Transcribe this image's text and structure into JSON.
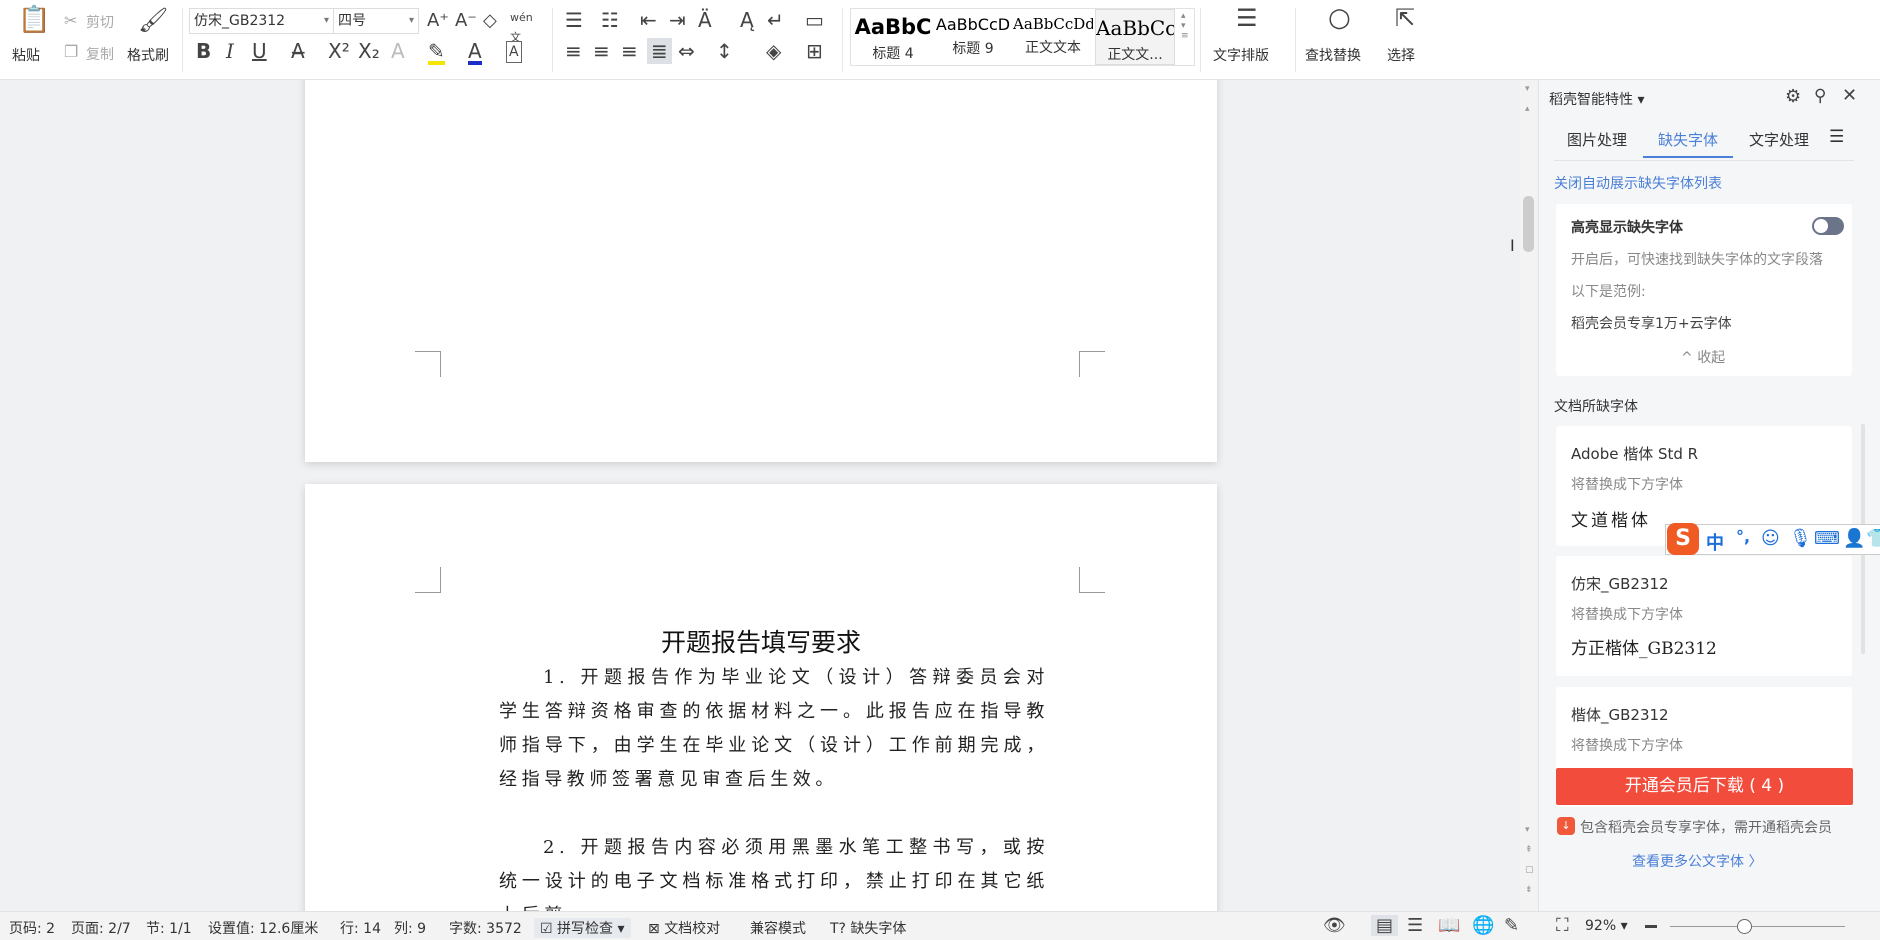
{
  "toolbar": {
    "paste": "粘贴",
    "cut": "剪切",
    "copy": "复制",
    "format_painter": "格式刷",
    "font_name": "仿宋_GB2312",
    "font_size": "四号",
    "styles": [
      {
        "preview": "AaBbC",
        "label": "标题 4"
      },
      {
        "preview": "AaBbCcD",
        "label": "标题 9"
      },
      {
        "preview": "AaBbCcDd",
        "label": "正文文本"
      },
      {
        "preview": "AaBbCc",
        "label": "正文文..."
      }
    ],
    "text_layout": "文字排版",
    "find_replace": "查找替换",
    "select": "选择",
    "pinyin": "wén"
  },
  "document": {
    "title": "开题报告填写要求",
    "paragraphs": [
      "1. 开题报告作为毕业论文（设计）答辩委员会对学生答辩资格审查的依据材料之一。此报告应在指导教师指导下，由学生在毕业论文（设计）工作前期完成，经指导教师签署意见审查后生效。",
      "2. 开题报告内容必须用黑墨水笔工整书写，或按统一设计的电子文档标准格式打印，禁止打印在其它纸上后剪"
    ]
  },
  "panel": {
    "title": "稻壳智能特性",
    "tabs": [
      "图片处理",
      "缺失字体",
      "文字处理"
    ],
    "active_tab": 1,
    "close_auto_link": "关闭自动展示缺失字体列表",
    "highlight": {
      "title": "高亮显示缺失字体",
      "enabled": false,
      "desc": "开启后，可快速找到缺失字体的文字段落",
      "example_label": "以下是范例:",
      "example": "稻壳会员专享1万+云字体",
      "collapse": "收起"
    },
    "missing_heading": "文档所缺字体",
    "fonts": [
      {
        "name": "Adobe 楷体 Std R",
        "hint": "将替换成下方字体",
        "replacement": "文道楷体"
      },
      {
        "name": "仿宋_GB2312",
        "hint": "将替换成下方字体",
        "replacement": "方正楷体_GB2312"
      },
      {
        "name": "楷体_GB2312",
        "hint": "将替换成下方字体",
        "replacement": ""
      }
    ],
    "download_button": "开通会员后下载 ( 4 )",
    "member_note": "包含稻壳会员专享字体，需开通稻壳会员",
    "more_link": "查看更多公文字体 〉",
    "accent": "#4a7fd6",
    "button_color": "#f24c3d"
  },
  "ime": {
    "lang": "中",
    "punct": "°,"
  },
  "status": {
    "page_code": "页码: 2",
    "page": "页面: 2/7",
    "section": "节: 1/1",
    "setting": "设置值: 12.6厘米",
    "row": "行: 14",
    "col": "列: 9",
    "word_count": "字数: 3572",
    "spell_check": "拼写检查",
    "doc_proof": "文档校对",
    "compat": "兼容模式",
    "missing_font": "缺失字体",
    "zoom": "92%",
    "zoom_percent": 92
  }
}
